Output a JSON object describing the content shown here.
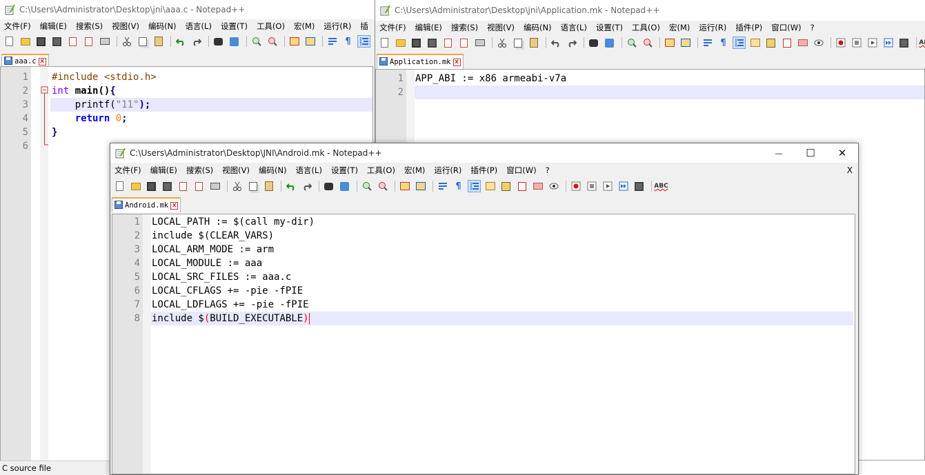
{
  "colors": {
    "current_line": "#e8e8ff",
    "tab_accent": "#f5a338",
    "keyword": "#0000ff",
    "preprocessor": "#804000",
    "string": "#808080",
    "number": "#ff8000"
  },
  "win_aaa": {
    "title": "C:\\Users\\Administrator\\Desktop\\jni\\aaa.c - Notepad++",
    "menus": [
      "文件(F)",
      "编辑(E)",
      "搜索(S)",
      "视图(V)",
      "编码(N)",
      "语言(L)",
      "设置(T)",
      "工具(O)",
      "宏(M)",
      "运行(R)",
      "插"
    ],
    "tab": "aaa.c",
    "line_numbers": [
      "1",
      "2",
      "3",
      "4",
      "5",
      "6"
    ],
    "code": {
      "l1": "#include <stdio.h>",
      "l2_kw": "int",
      "l2_rest": " main()",
      "l2_brace": "{",
      "l3_indent": "    printf(",
      "l3_str": "\"11\"",
      "l3_end": ");",
      "l4_indent": "    ",
      "l4_kw": "return",
      "l4_num": " 0",
      "l4_end": ";",
      "l5": "}"
    },
    "status": "C source file"
  },
  "win_app": {
    "title": "C:\\Users\\Administrator\\Desktop\\jni\\Application.mk - Notepad++",
    "menus": [
      "文件(F)",
      "编辑(E)",
      "搜索(S)",
      "视图(V)",
      "编码(N)",
      "语言(L)",
      "设置(T)",
      "工具(O)",
      "宏(M)",
      "运行(R)",
      "插件(P)",
      "窗口(W)",
      "?"
    ],
    "tab": "Application.mk",
    "line_numbers": [
      "1",
      "2"
    ],
    "lines": [
      "APP_ABI := x86 armeabi-v7a",
      ""
    ]
  },
  "win_android": {
    "title": "C:\\Users\\Administrator\\Desktop\\JNI\\Android.mk - Notepad++",
    "menus": [
      "文件(F)",
      "编辑(E)",
      "搜索(S)",
      "视图(V)",
      "编码(N)",
      "语言(L)",
      "设置(T)",
      "工具(O)",
      "宏(M)",
      "运行(R)",
      "插件(P)",
      "窗口(W)",
      "?"
    ],
    "menu_close": "X",
    "tab": "Android.mk",
    "line_numbers": [
      "1",
      "2",
      "3",
      "4",
      "5",
      "6",
      "7",
      "8"
    ],
    "lines": [
      "LOCAL_PATH := $(call my-dir)",
      "include $(CLEAR_VARS)",
      "LOCAL_ARM_MODE := arm",
      "LOCAL_MODULE := aaa",
      "LOCAL_SRC_FILES := aaa.c",
      "LOCAL_CFLAGS += -pie -fPIE",
      "LOCAL_LDFLAGS += -pie -fPIE"
    ],
    "line8_pre": "include $",
    "line8_paren": "(",
    "line8_mid": "BUILD_EXECUTABLE",
    "line8_close": ")",
    "controls": {
      "minimize": "—",
      "maximize": "☐",
      "close": "✕"
    }
  }
}
